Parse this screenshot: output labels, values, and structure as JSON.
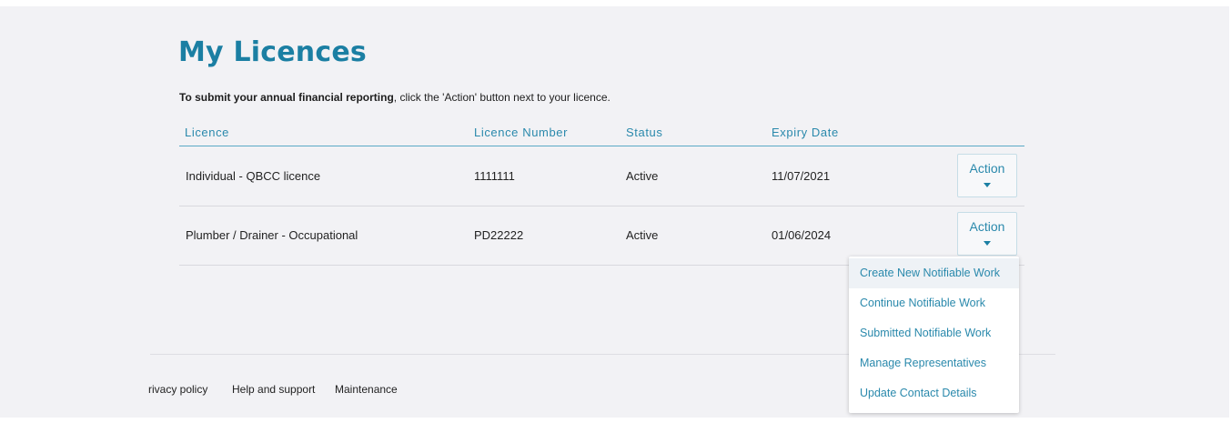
{
  "page": {
    "title": "My Licences",
    "intro_bold": "To submit your annual financial reporting",
    "intro_rest": ", click the 'Action' button next to your licence."
  },
  "table": {
    "headers": [
      "Licence",
      "Licence Number",
      "Status",
      "Expiry Date"
    ],
    "rows": [
      {
        "licence": "Individual - QBCC licence",
        "number": "1111111",
        "status": "Active",
        "expiry": "11/07/2021",
        "action": "Action"
      },
      {
        "licence": "Plumber / Drainer - Occupational",
        "number": "PD22222",
        "status": "Active",
        "expiry": "01/06/2024",
        "action": "Action"
      }
    ]
  },
  "dropdown": {
    "items": [
      "Create New Notifiable Work",
      "Continue Notifiable Work",
      "Submitted Notifiable Work",
      "Manage Representatives",
      "Update Contact Details"
    ],
    "highlighted_index": 0
  },
  "footer": {
    "links": [
      "rivacy policy",
      "Help and support",
      "Maintenance"
    ]
  },
  "colors": {
    "accent": "#1b7fa3",
    "header_text": "#2a89ac",
    "background": "#f2f2f5"
  },
  "icons": {
    "action_caret": "caret-down-icon"
  }
}
